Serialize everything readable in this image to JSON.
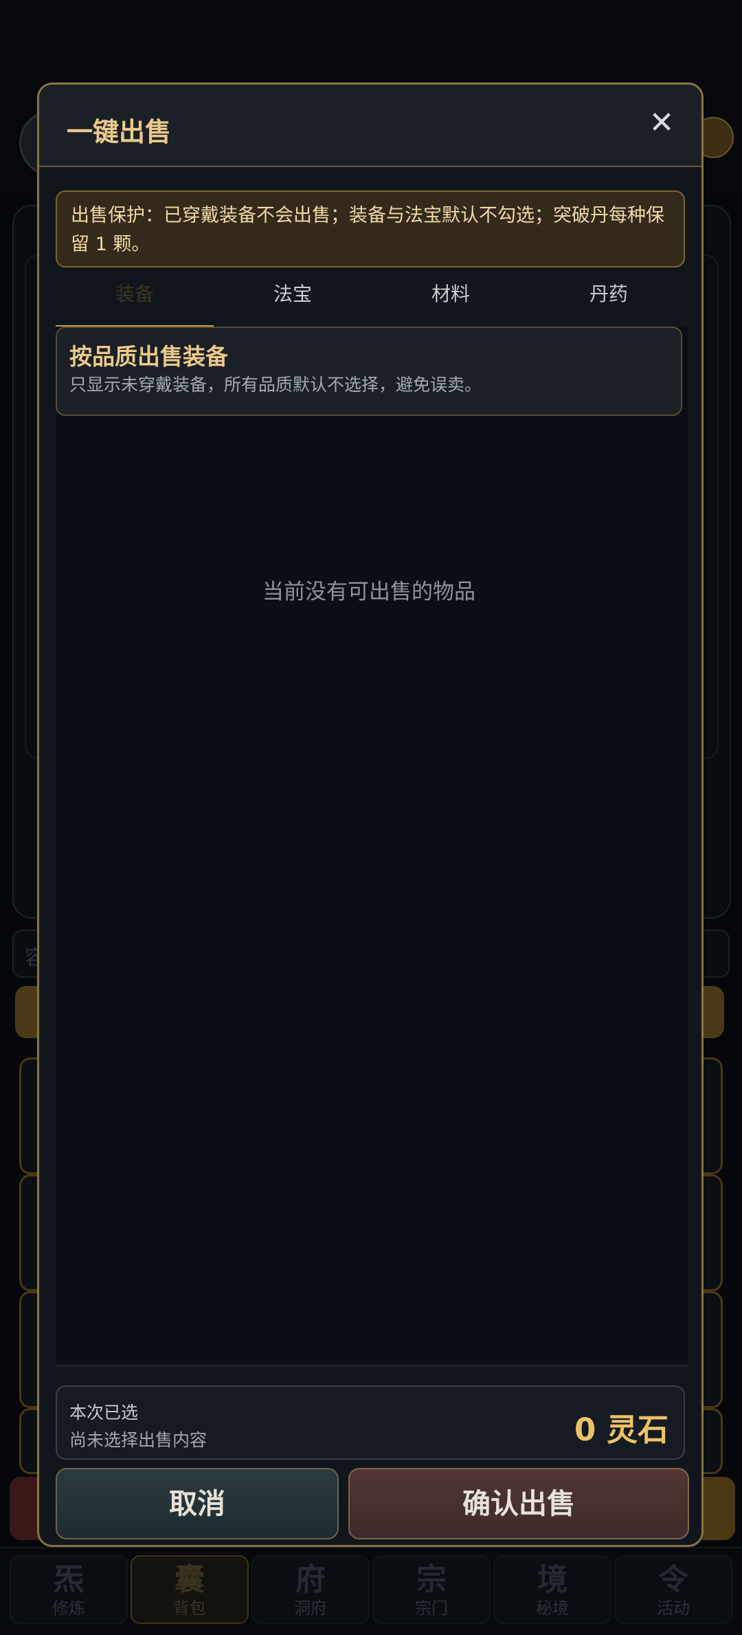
{
  "modal": {
    "title": "一键出售",
    "close_glyph": "✕",
    "notice": "出售保护：已穿戴装备不会出售；装备与法宝默认不勾选；突破丹每种保留 1 颗。",
    "tabs": [
      {
        "label": "装备",
        "active": true
      },
      {
        "label": "法宝",
        "active": false
      },
      {
        "label": "材料",
        "active": false
      },
      {
        "label": "丹药",
        "active": false
      }
    ],
    "quality_section": {
      "title": "按品质出售装备",
      "subtitle": "只显示未穿戴装备，所有品质默认不选择，避免误卖。"
    },
    "empty_message": "当前没有可出售的物品",
    "summary": {
      "label": "本次已选",
      "status": "尚未选择出售内容",
      "amount": "0 灵石"
    },
    "cancel_label": "取消",
    "confirm_label": "确认出售"
  },
  "background": {
    "search_hint": "容",
    "nav": [
      {
        "glyph": "炁",
        "label": "修炼",
        "active": false
      },
      {
        "glyph": "囊",
        "label": "背包",
        "active": true
      },
      {
        "glyph": "府",
        "label": "洞府",
        "active": false
      },
      {
        "glyph": "宗",
        "label": "宗门",
        "active": false
      },
      {
        "glyph": "境",
        "label": "秘境",
        "active": false
      },
      {
        "glyph": "令",
        "label": "活动",
        "active": false
      }
    ]
  },
  "colors": {
    "accent_gold": "#ecc98a",
    "modal_border": "#8a7444",
    "amount": "#ecc266"
  }
}
